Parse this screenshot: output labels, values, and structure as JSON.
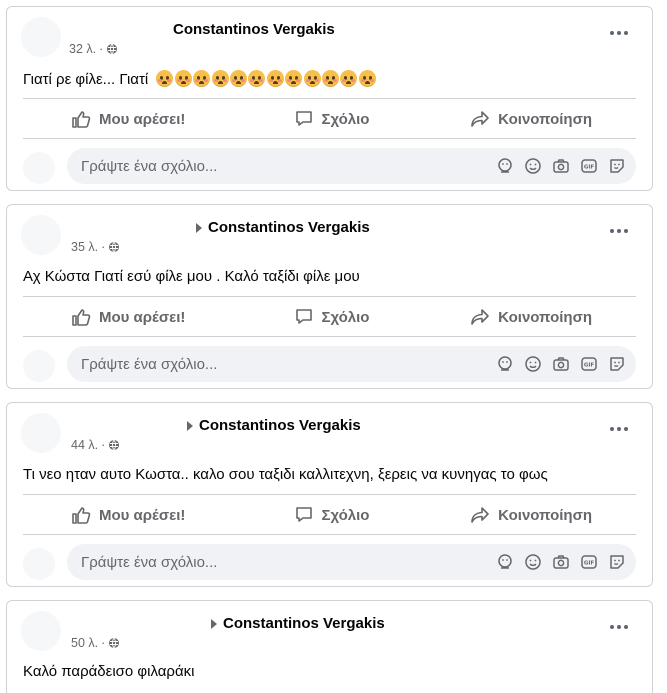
{
  "posts": [
    {
      "page_name": "Constantinos Vergakis",
      "time": "32 λ.",
      "text": "Γιατί ρε φίλε... Γιατί",
      "emoji_count": 12,
      "like_label": "Μου αρέσει!",
      "comment_label": "Σχόλιο",
      "share_label": "Κοινοποίηση",
      "comment_placeholder": "Γράψτε ένα σχόλιο..."
    },
    {
      "page_name": "Constantinos Vergakis",
      "time": "35 λ.",
      "text": "Αχ Κώστα Γιατί εσύ φίλε μου . Καλό ταξίδι φίλε μου",
      "like_label": "Μου αρέσει!",
      "comment_label": "Σχόλιο",
      "share_label": "Κοινοποίηση",
      "comment_placeholder": "Γράψτε ένα σχόλιο..."
    },
    {
      "page_name": "Constantinos Vergakis",
      "time": "44 λ.",
      "text": "Τι νεο ηταν αυτο Κωστα.. καλο σου ταξιδι καλλιτεχνη, ξερεις να κυνηγας το φως",
      "like_label": "Μου αρέσει!",
      "comment_label": "Σχόλιο",
      "share_label": "Κοινοποίηση",
      "comment_placeholder": "Γράψτε ένα σχόλιο..."
    },
    {
      "page_name": "Constantinos Vergakis",
      "time": "50 λ.",
      "text": "Καλό παράδεισο φιλαράκι"
    }
  ],
  "icons": {
    "visibility": "globe-icon",
    "more": "more-options-icon",
    "like": "thumbs-up-icon",
    "comment": "comment-bubble-icon",
    "share": "share-arrow-icon",
    "avatar_sticker": "avatar-sticker-icon",
    "emoji": "smiley-icon",
    "camera": "camera-icon",
    "gif": "gif-icon",
    "sticker": "sticker-icon"
  },
  "colors": {
    "text": "#050505",
    "secondary": "#65676b",
    "input_bg": "#f0f2f5",
    "border": "#ced0d4"
  }
}
